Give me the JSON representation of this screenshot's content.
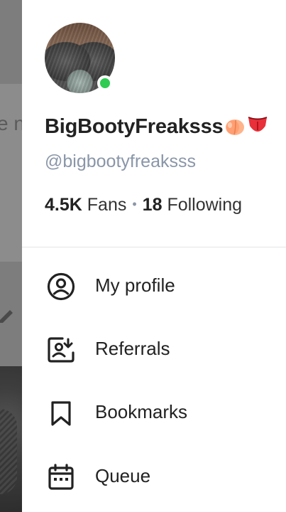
{
  "backdrop": {
    "partial_text": "e n"
  },
  "profile": {
    "display_name": "BigBootyFreaksss",
    "name_emojis": [
      "peach-emoji",
      "tongue-emoji"
    ],
    "handle": "@bigbootyfreaksss",
    "online": true,
    "fans_count": "4.5K",
    "fans_label": "Fans",
    "separator": "•",
    "following_count": "18",
    "following_label": "Following"
  },
  "menu": [
    {
      "icon": "user-circle-icon",
      "label": "My profile"
    },
    {
      "icon": "referrals-icon",
      "label": "Referrals"
    },
    {
      "icon": "bookmark-icon",
      "label": "Bookmarks"
    },
    {
      "icon": "calendar-icon",
      "label": "Queue"
    }
  ],
  "colors": {
    "online": "#2ecc52",
    "handle": "#8a96a8",
    "text": "#222222",
    "drawer_bg": "#ffffff"
  }
}
